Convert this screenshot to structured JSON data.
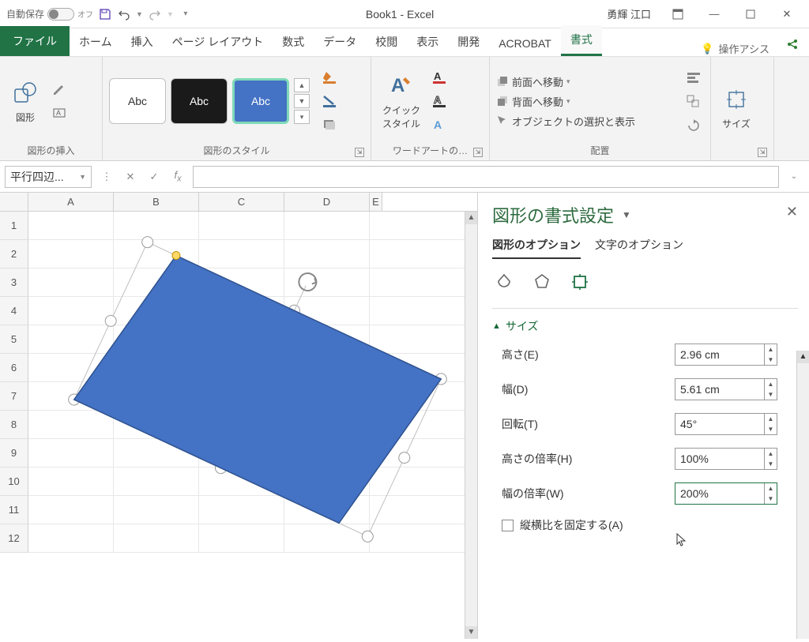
{
  "titlebar": {
    "autosave_label": "自動保存",
    "autosave_state": "オフ",
    "title": "Book1 - Excel",
    "user": "勇輝 江口"
  },
  "ribbon_tabs": {
    "file": "ファイル",
    "home": "ホーム",
    "insert": "挿入",
    "page_layout": "ページ レイアウト",
    "formulas": "数式",
    "data": "データ",
    "review": "校閲",
    "view": "表示",
    "developer": "開発",
    "acrobat": "ACROBAT",
    "format": "書式",
    "tell_me": "操作アシス"
  },
  "ribbon": {
    "insert_shapes": {
      "shapes": "図形",
      "group": "図形の挿入"
    },
    "styles": {
      "abc": "Abc",
      "group": "図形のスタイル"
    },
    "quickstyle": "クイック\nスタイル",
    "wordart_group": "ワードアートの…",
    "arrange": {
      "front": "前面へ移動",
      "back": "背面へ移動",
      "select": "オブジェクトの選択と表示",
      "group": "配置"
    },
    "size": {
      "label": "サイズ"
    }
  },
  "namebox": "平行四辺...",
  "columns": [
    "A",
    "B",
    "C",
    "D",
    "E"
  ],
  "rows": [
    "1",
    "2",
    "3",
    "4",
    "5",
    "6",
    "7",
    "8",
    "9",
    "10",
    "11",
    "12"
  ],
  "format_pane": {
    "title": "図形の書式設定",
    "tab_shape": "図形のオプション",
    "tab_text": "文字のオプション",
    "section_size": "サイズ",
    "height_label": "高さ(E)",
    "height_value": "2.96 cm",
    "width_label": "幅(D)",
    "width_value": "5.61 cm",
    "rotation_label": "回転(T)",
    "rotation_value": "45°",
    "scale_h_label": "高さの倍率(H)",
    "scale_h_value": "100%",
    "scale_w_label": "幅の倍率(W)",
    "scale_w_value": "200%",
    "lock_aspect": "縦横比を固定する(A)"
  }
}
